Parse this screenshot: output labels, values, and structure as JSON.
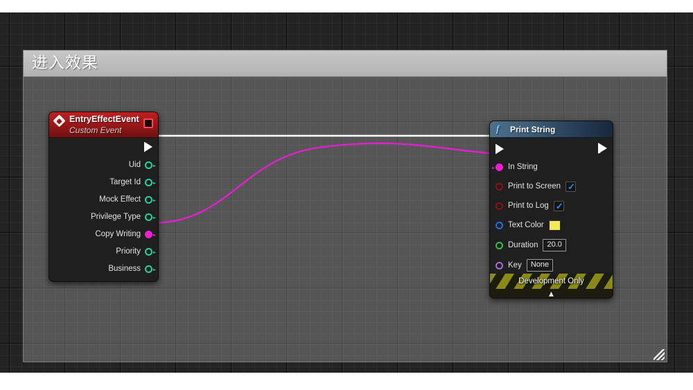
{
  "canvas": {
    "background_color": "#232323",
    "grid_minor_color": "#2e2e2e",
    "grid_major_color": "#0d0d0d"
  },
  "comment": {
    "title": "进入效果",
    "header_color": "#bcbcbc",
    "body_color": "#808080",
    "resize_grip": "resize-grip"
  },
  "event_node": {
    "title": "EntryEffectEvent",
    "subtitle": "Custom Event",
    "header_color": "#9a1818",
    "icon": "event-diamond-icon",
    "flag_icon": "red-square-flag",
    "exec_out": {
      "label": "",
      "type": "exec",
      "connected": true
    },
    "pins": [
      {
        "label": "Uid",
        "type": "struct",
        "color": "#20d6a0",
        "filled": false,
        "connected": false
      },
      {
        "label": "Target Id",
        "type": "struct",
        "color": "#20d6a0",
        "filled": false,
        "connected": false
      },
      {
        "label": "Mock Effect",
        "type": "struct",
        "color": "#20d6a0",
        "filled": false,
        "connected": false
      },
      {
        "label": "Privilege Type",
        "type": "struct",
        "color": "#20d6a0",
        "filled": false,
        "connected": false
      },
      {
        "label": "Copy Writing",
        "type": "string",
        "color": "#ee1fd0",
        "filled": true,
        "connected": true
      },
      {
        "label": "Priority",
        "type": "struct",
        "color": "#20d6a0",
        "filled": false,
        "connected": false
      },
      {
        "label": "Business",
        "type": "struct",
        "color": "#20d6a0",
        "filled": false,
        "connected": false
      }
    ]
  },
  "function_node": {
    "title": "Print String",
    "icon": "function-f-icon",
    "header_color": "#3b5a75",
    "exec_in": {
      "type": "exec",
      "connected": true
    },
    "exec_out": {
      "type": "exec",
      "connected": false
    },
    "pins": [
      {
        "label": "In String",
        "type": "string",
        "color": "#ee1fd0",
        "filled": true,
        "connected": true,
        "widget": "none"
      },
      {
        "label": "Print to Screen",
        "type": "boolean",
        "color": "#8c1111",
        "filled": false,
        "connected": false,
        "widget": "checkbox",
        "checked": true
      },
      {
        "label": "Print to Log",
        "type": "boolean",
        "color": "#8c1111",
        "filled": false,
        "connected": false,
        "widget": "checkbox",
        "checked": true
      },
      {
        "label": "Text Color",
        "type": "struct",
        "color": "#1f6feb",
        "filled": false,
        "connected": false,
        "widget": "color",
        "value": "#f2e85c"
      },
      {
        "label": "Duration",
        "type": "float",
        "color": "#2fbf3f",
        "filled": false,
        "connected": false,
        "widget": "text",
        "value": "20.0"
      },
      {
        "label": "Key",
        "type": "name",
        "color": "#b06ae0",
        "filled": false,
        "connected": false,
        "widget": "text",
        "value": "None"
      }
    ],
    "footer": {
      "label": "Development Only",
      "stripe_color": "#8a8a18",
      "collapse_icon": "chevron-up-icon"
    }
  },
  "wires": [
    {
      "name": "exec-wire",
      "color": "#ffffff",
      "from": "EntryEffectEvent exec out",
      "to": "Print String exec in"
    },
    {
      "name": "string-wire",
      "color": "#e41fd0",
      "from": "Copy Writing",
      "to": "In String"
    }
  ]
}
